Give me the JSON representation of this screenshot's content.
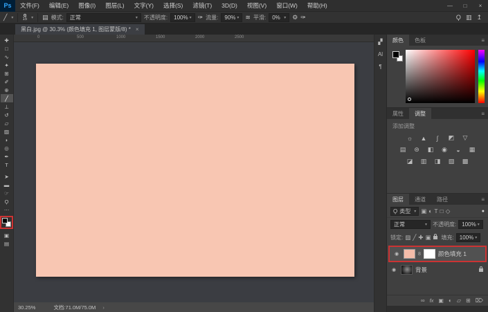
{
  "menubar": {
    "logo": "Ps",
    "items": [
      "文件(F)",
      "编辑(E)",
      "图像(I)",
      "图层(L)",
      "文字(Y)",
      "选择(S)",
      "滤镜(T)",
      "3D(D)",
      "视图(V)",
      "窗口(W)",
      "帮助(H)"
    ],
    "window_controls": {
      "minimize": "—",
      "maximize": "□",
      "close": "×"
    }
  },
  "options": {
    "tool_icon": "╱",
    "caret": "▾",
    "brush_size": "15",
    "panel_toggle_icon": "▤",
    "mode_label": "模式:",
    "mode_value": "正常",
    "opacity_label": "不透明度:",
    "opacity_value": "100%",
    "pressure_icon": "✑",
    "flow_label": "流量:",
    "flow_value": "90%",
    "airbrush_icon": "≋",
    "smooth_label": "平滑:",
    "smooth_value": "0%",
    "gear_icon": "⚙",
    "smooth_pressure_icon": "✑",
    "search_icon": "Ϙ",
    "workspace_icon": "▥",
    "share_icon": "↥"
  },
  "tabbar": {
    "title": "黑白.jpg @ 30.3% (颜色填充 1, 图层蒙版/8) *",
    "close": "×"
  },
  "ruler": {
    "ticks": [
      "0",
      "500",
      "1000",
      "1500",
      "2000",
      "2500"
    ]
  },
  "toolbar": {
    "tools": [
      {
        "name": "move-tool",
        "glyph": "✚"
      },
      {
        "name": "marquee-tool",
        "glyph": "□"
      },
      {
        "name": "lasso-tool",
        "glyph": "∿"
      },
      {
        "name": "object-selection-tool",
        "glyph": "✦"
      },
      {
        "name": "crop-tool",
        "glyph": "⊞"
      },
      {
        "name": "eyedropper-tool",
        "glyph": "✐"
      },
      {
        "name": "healing-brush-tool",
        "glyph": "⊕"
      },
      {
        "name": "brush-tool",
        "glyph": "╱"
      },
      {
        "name": "clone-stamp-tool",
        "glyph": "⊥"
      },
      {
        "name": "history-brush-tool",
        "glyph": "↺"
      },
      {
        "name": "eraser-tool",
        "glyph": "▱"
      },
      {
        "name": "gradient-tool",
        "glyph": "▨"
      },
      {
        "name": "blur-tool",
        "glyph": "◗"
      },
      {
        "name": "dodge-tool",
        "glyph": "◎"
      },
      {
        "name": "pen-tool",
        "glyph": "✒"
      },
      {
        "name": "type-tool",
        "glyph": "T"
      }
    ],
    "tools_bottom": [
      {
        "name": "path-selection-tool",
        "glyph": "➤"
      },
      {
        "name": "shape-tool",
        "glyph": "▬"
      },
      {
        "name": "hand-tool",
        "glyph": "☞"
      },
      {
        "name": "zoom-tool",
        "glyph": "Ϙ"
      },
      {
        "name": "edit-toolbar",
        "glyph": "⋯"
      }
    ],
    "tools_below_swatches": [
      {
        "name": "quick-mask",
        "glyph": "▣"
      },
      {
        "name": "screen-mode",
        "glyph": "▤"
      }
    ]
  },
  "dock": {
    "icons": [
      {
        "name": "brush-settings",
        "glyph": "▞"
      },
      {
        "name": "libraries",
        "glyph": "Al"
      },
      {
        "name": "paragraph",
        "glyph": "¶"
      }
    ]
  },
  "color_panel": {
    "tab_color": "颜色",
    "tab_swatches": "色板",
    "menu_icon": "≡"
  },
  "adjustments_panel": {
    "tab_properties": "属性",
    "tab_adjustments": "调整",
    "menu_icon": "≡",
    "add_label": "添加调整",
    "icons": [
      {
        "name": "brightness-contrast",
        "glyph": "☼"
      },
      {
        "name": "levels",
        "glyph": "▲"
      },
      {
        "name": "curves",
        "glyph": "∫"
      },
      {
        "name": "exposure",
        "glyph": "◩"
      },
      {
        "name": "vibrance",
        "glyph": "▽"
      },
      {
        "name": "hue-saturation",
        "glyph": "▤"
      },
      {
        "name": "color-balance",
        "glyph": "⊜"
      },
      {
        "name": "black-white",
        "glyph": "◧"
      },
      {
        "name": "photo-filter",
        "glyph": "◉"
      },
      {
        "name": "channel-mixer",
        "glyph": "◒"
      },
      {
        "name": "color-lookup",
        "glyph": "▦"
      },
      {
        "name": "invert",
        "glyph": "◪"
      },
      {
        "name": "posterize",
        "glyph": "▥"
      },
      {
        "name": "threshold",
        "glyph": "◨"
      },
      {
        "name": "gradient-map",
        "glyph": "▧"
      },
      {
        "name": "selective-color",
        "glyph": "▩"
      }
    ]
  },
  "layers_panel": {
    "tab_layers": "图层",
    "tab_channels": "通道",
    "tab_paths": "路径",
    "menu_icon": "≡",
    "filter": {
      "search_icon": "Ϙ",
      "kind_value": "类型",
      "caret": "▾",
      "icons": [
        {
          "name": "filter-pixel",
          "glyph": "▣"
        },
        {
          "name": "filter-adjustment",
          "glyph": "◐"
        },
        {
          "name": "filter-type",
          "glyph": "T"
        },
        {
          "name": "filter-group",
          "glyph": "□"
        },
        {
          "name": "filter-smart-object",
          "glyph": "◇"
        }
      ],
      "pin_icon": "●"
    },
    "blend_value": "正常",
    "opacity_label": "不透明度:",
    "opacity_value": "100%",
    "lock_label": "锁定:",
    "lock_icons": [
      {
        "name": "lock-transparency",
        "glyph": "▨"
      },
      {
        "name": "lock-pixels",
        "glyph": "╱"
      },
      {
        "name": "lock-position",
        "glyph": "✚"
      },
      {
        "name": "lock-artboard",
        "glyph": "▣"
      }
    ],
    "fill_label": "填充:",
    "fill_value": "100%",
    "eye_icon": "◉",
    "link_icon": "8",
    "layers": [
      {
        "name": "颜色填充 1"
      },
      {
        "name": "背景"
      }
    ],
    "bottom_icons": [
      {
        "name": "link-layers",
        "glyph": "∞"
      },
      {
        "name": "layer-style",
        "glyph": "fx"
      },
      {
        "name": "add-mask",
        "glyph": "▣"
      },
      {
        "name": "new-adjustment",
        "glyph": "◐"
      },
      {
        "name": "new-group",
        "glyph": "▱"
      },
      {
        "name": "new-layer",
        "glyph": "⊞"
      },
      {
        "name": "delete-layer",
        "glyph": "⌦"
      }
    ]
  },
  "statusbar": {
    "zoom": "30.25%",
    "doc_info": "文档:71.0M/75.0M",
    "arrow": "›"
  },
  "colors": {
    "canvas_fill": "#f8c6b2",
    "highlight_red": "#cc3333",
    "logo_blue": "#31a8ff"
  }
}
